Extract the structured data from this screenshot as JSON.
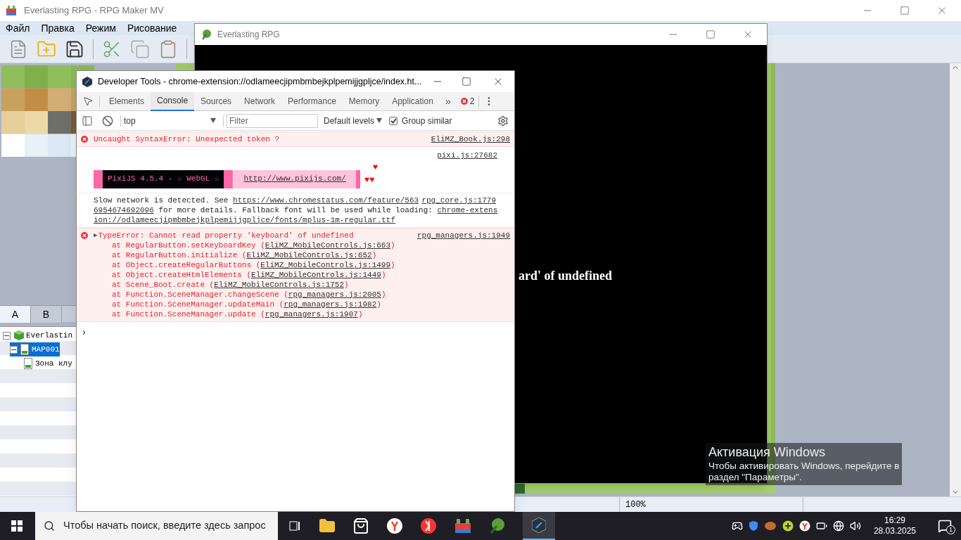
{
  "main_window": {
    "title": "Everlasting RPG - RPG Maker MV",
    "menu": [
      "Файл",
      "Правка",
      "Режим",
      "Рисование"
    ],
    "tileset_tabs": [
      {
        "label": "A",
        "selected": true
      },
      {
        "label": "B",
        "selected": false
      }
    ],
    "map_tree": [
      {
        "label": "Everlastin",
        "selected": false,
        "expanded": true,
        "kind": "project",
        "children": [
          {
            "label": "MAP001",
            "selected": true,
            "expanded": true,
            "kind": "map",
            "children": [
              {
                "label": "Зона клу",
                "selected": false,
                "kind": "map"
              }
            ]
          }
        ]
      }
    ],
    "status_bar": {
      "zoom": "100%"
    }
  },
  "game_window": {
    "title": "Everlasting RPG",
    "error_text": "ard' of undefined"
  },
  "devtools": {
    "title": "Developer Tools - chrome-extension://odlameecjipmbmbejkplpemijjgpljce/index.ht...",
    "tabs": [
      {
        "label": "Elements",
        "selected": false
      },
      {
        "label": "Console",
        "selected": true
      },
      {
        "label": "Sources",
        "selected": false
      },
      {
        "label": "Network",
        "selected": false
      },
      {
        "label": "Performance",
        "selected": false
      },
      {
        "label": "Memory",
        "selected": false
      },
      {
        "label": "Application",
        "selected": false
      }
    ],
    "more": "»",
    "error_count": "2",
    "context": "top",
    "filter_placeholder": "Filter",
    "levels": "Default levels",
    "group_similar": {
      "label": "Group similar",
      "checked": true
    },
    "messages": [
      {
        "kind": "error",
        "text": "Uncaught SyntaxError: Unexpected token ?",
        "source": "EliMZ_Book.js:298"
      },
      {
        "kind": "banner",
        "source": "pixi.js:27682",
        "label": "PixiJS 4.5.4 - ☆ WebGL ☆",
        "link": "http://www.pixijs.com/",
        "heart_top": "♥",
        "hearts": "♥♥"
      },
      {
        "kind": "log",
        "source": "rpg_core.js:1779",
        "lines": [
          [
            {
              "text": "Slow network is detected. See ",
              "link": false
            },
            {
              "text": "https://www.chromestatus.com/feature/563",
              "link": true
            }
          ],
          [
            {
              "text": "6954674692096",
              "link": true
            },
            {
              "text": " for more details. Fallback font will be used while loading: ",
              "link": false
            },
            {
              "text": "chrome-extens",
              "link": true
            }
          ],
          [
            {
              "text": "ion://odlameecjipmbmbejkplpemijjgpljce/fonts/mplus-1m-regular.ttf",
              "link": true
            }
          ]
        ]
      },
      {
        "kind": "error",
        "toggle": "▶",
        "text": "TypeError: Cannot read property 'keyboard' of undefined",
        "source": "rpg_managers.js:1949",
        "stack": [
          {
            "prefix": "at RegularButton.setKeyboardKey (",
            "link": "EliMZ_MobileControls.js:663",
            "suffix": ")"
          },
          {
            "prefix": "at RegularButton.initialize (",
            "link": "EliMZ_MobileControls.js:652",
            "suffix": ")"
          },
          {
            "prefix": "at Object.createRegularButtons (",
            "link": "EliMZ_MobileControls.js:1499",
            "suffix": ")"
          },
          {
            "prefix": "at Object.createHtmlElements (",
            "link": "EliMZ_MobileControls.js:1449",
            "suffix": ")"
          },
          {
            "prefix": "at Scene_Boot.create (",
            "link": "EliMZ_MobileControls.js:1752",
            "suffix": ")"
          },
          {
            "prefix": "at Function.SceneManager.changeScene (",
            "link": "rpg_managers.js:2005",
            "suffix": ")"
          },
          {
            "prefix": "at Function.SceneManager.updateMain (",
            "link": "rpg_managers.js:1982",
            "suffix": ")"
          },
          {
            "prefix": "at Function.SceneManager.update (",
            "link": "rpg_managers.js:1907",
            "suffix": ")"
          }
        ]
      }
    ],
    "prompt": "›"
  },
  "activation": {
    "title": "Активация Windows",
    "line1": "Чтобы активировать Windows, перейдите в",
    "line2": "раздел \"Параметры\"."
  },
  "taskbar": {
    "search_placeholder": "Чтобы начать поиск, введите здесь запрос",
    "time": "16:29",
    "date": "28.03.2025",
    "notifications": "1"
  }
}
